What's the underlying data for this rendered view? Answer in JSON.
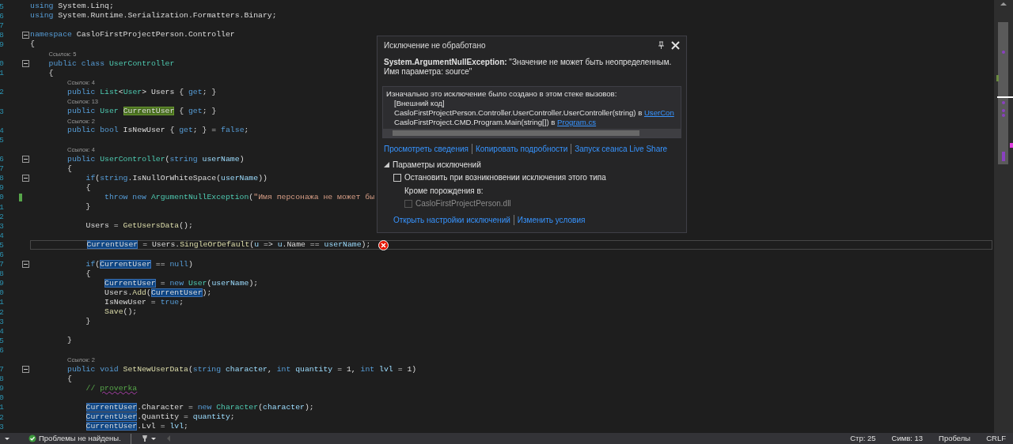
{
  "editor": {
    "lines": [
      {
        "kind": "code",
        "number": "5",
        "fold": false,
        "tokens": [
          {
            "text": "using",
            "kind": "k"
          },
          {
            "text": " System.Linq;",
            "kind": "n"
          }
        ]
      },
      {
        "kind": "code",
        "number": "6",
        "fold": false,
        "tokens": [
          {
            "text": "using",
            "kind": "k"
          },
          {
            "text": " System.Runtime.Serialization.Formatters.Binary;",
            "kind": "n"
          }
        ]
      },
      {
        "kind": "code",
        "number": "7",
        "fold": false
      },
      {
        "kind": "code",
        "number": "8",
        "fold": true,
        "tokens": [
          {
            "text": "namespace",
            "kind": "k"
          },
          {
            "text": " CasloFirstProjectPerson.Controller",
            "kind": "n"
          }
        ]
      },
      {
        "kind": "code",
        "number": "9",
        "fold": false,
        "tokens": [
          {
            "text": "{",
            "kind": "n"
          }
        ]
      },
      {
        "kind": "lens",
        "text": "    Ссылок: 5"
      },
      {
        "kind": "code",
        "number": "0",
        "fold": true,
        "tokens": [
          {
            "text": "    public class ",
            "kind": "k"
          },
          {
            "text": "UserController",
            "kind": "t"
          }
        ]
      },
      {
        "kind": "code",
        "number": "1",
        "fold": false,
        "tokens": [
          {
            "text": "    {",
            "kind": "n"
          }
        ]
      },
      {
        "kind": "lens",
        "text": "        Ссылок: 4"
      },
      {
        "kind": "code",
        "number": "2",
        "fold": false,
        "tokens": [
          {
            "text": "        public ",
            "kind": "k"
          },
          {
            "text": "List",
            "kind": "t"
          },
          {
            "text": "<",
            "kind": "n"
          },
          {
            "text": "User",
            "kind": "t"
          },
          {
            "text": "> Users { ",
            "kind": "n"
          },
          {
            "text": "get",
            "kind": "k"
          },
          {
            "text": "; }",
            "kind": "n"
          }
        ]
      },
      {
        "kind": "lens",
        "text": "        Ссылок: 13"
      },
      {
        "kind": "code",
        "number": "3",
        "fold": false,
        "tokens": [
          {
            "text": "        public ",
            "kind": "k"
          },
          {
            "text": "User ",
            "kind": "t"
          },
          {
            "text": "CurrentUser",
            "kind": "d"
          },
          {
            "text": " { ",
            "kind": "n"
          },
          {
            "text": "get",
            "kind": "k"
          },
          {
            "text": "; }",
            "kind": "n"
          }
        ]
      },
      {
        "kind": "lens",
        "text": "        Ссылок: 2"
      },
      {
        "kind": "code",
        "number": "4",
        "fold": false,
        "tokens": [
          {
            "text": "        public bool",
            "kind": "k"
          },
          {
            "text": " IsNewUser { ",
            "kind": "n"
          },
          {
            "text": "get",
            "kind": "k"
          },
          {
            "text": "; } = ",
            "kind": "n"
          },
          {
            "text": "false",
            "kind": "k"
          },
          {
            "text": ";",
            "kind": "n"
          }
        ]
      },
      {
        "kind": "code",
        "number": "5",
        "fold": false
      },
      {
        "kind": "lens",
        "text": "        Ссылок: 4"
      },
      {
        "kind": "code",
        "number": "6",
        "fold": true,
        "tokens": [
          {
            "text": "        public ",
            "kind": "k"
          },
          {
            "text": "UserController",
            "kind": "t"
          },
          {
            "text": "(",
            "kind": "n"
          },
          {
            "text": "string ",
            "kind": "k"
          },
          {
            "text": "userName",
            "kind": "p"
          },
          {
            "text": ")",
            "kind": "n"
          }
        ]
      },
      {
        "kind": "code",
        "number": "7",
        "fold": false,
        "tokens": [
          {
            "text": "        {",
            "kind": "n"
          }
        ]
      },
      {
        "kind": "code",
        "number": "8",
        "fold": true,
        "tokens": [
          {
            "text": "            if",
            "kind": "k"
          },
          {
            "text": "(",
            "kind": "n"
          },
          {
            "text": "string",
            "kind": "k"
          },
          {
            "text": ".IsNullOrWhiteSpace(",
            "kind": "n"
          },
          {
            "text": "userName",
            "kind": "p"
          },
          {
            "text": "))",
            "kind": "n"
          }
        ]
      },
      {
        "kind": "code",
        "number": "9",
        "fold": false,
        "tokens": [
          {
            "text": "            {",
            "kind": "n"
          }
        ]
      },
      {
        "kind": "code",
        "number": "0",
        "fold": false,
        "changed": true,
        "tokens": [
          {
            "text": "                throw new ",
            "kind": "k"
          },
          {
            "text": "ArgumentNullException",
            "kind": "t"
          },
          {
            "text": "(",
            "kind": "n"
          },
          {
            "text": "\"Имя персонажа не может бы",
            "kind": "s"
          }
        ]
      },
      {
        "kind": "code",
        "number": "1",
        "fold": false,
        "tokens": [
          {
            "text": "            }",
            "kind": "n"
          }
        ]
      },
      {
        "kind": "code",
        "number": "2",
        "fold": false
      },
      {
        "kind": "code",
        "number": "3",
        "fold": false,
        "tokens": [
          {
            "text": "            Users = ",
            "kind": "n"
          },
          {
            "text": "GetUsersData",
            "kind": "m"
          },
          {
            "text": "();",
            "kind": "n"
          }
        ]
      },
      {
        "kind": "code",
        "number": "4",
        "fold": false
      },
      {
        "kind": "code",
        "number": "5",
        "fold": false,
        "current": true,
        "error": true,
        "tokens": [
          {
            "text": "            CurrentUser",
            "kind": "r"
          },
          {
            "text": " = Users.",
            "kind": "n"
          },
          {
            "text": "SingleOrDefault",
            "kind": "m"
          },
          {
            "text": "(",
            "kind": "n"
          },
          {
            "text": "u",
            "kind": "p"
          },
          {
            "text": " => ",
            "kind": "n"
          },
          {
            "text": "u",
            "kind": "p"
          },
          {
            "text": ".Name == ",
            "kind": "n"
          },
          {
            "text": "userName",
            "kind": "p"
          },
          {
            "text": ");",
            "kind": "n"
          }
        ]
      },
      {
        "kind": "code",
        "number": "6",
        "fold": false
      },
      {
        "kind": "code",
        "number": "7",
        "fold": true,
        "tokens": [
          {
            "text": "            if",
            "kind": "k"
          },
          {
            "text": "(",
            "kind": "n"
          },
          {
            "text": "CurrentUser",
            "kind": "r"
          },
          {
            "text": " == ",
            "kind": "n"
          },
          {
            "text": "null",
            "kind": "k"
          },
          {
            "text": ")",
            "kind": "n"
          }
        ]
      },
      {
        "kind": "code",
        "number": "8",
        "fold": false,
        "tokens": [
          {
            "text": "            {",
            "kind": "n"
          }
        ]
      },
      {
        "kind": "code",
        "number": "9",
        "fold": false,
        "tokens": [
          {
            "text": "                CurrentUser",
            "kind": "r"
          },
          {
            "text": " = ",
            "kind": "n"
          },
          {
            "text": "new ",
            "kind": "k"
          },
          {
            "text": "User",
            "kind": "t"
          },
          {
            "text": "(",
            "kind": "n"
          },
          {
            "text": "userName",
            "kind": "p"
          },
          {
            "text": ");",
            "kind": "n"
          }
        ]
      },
      {
        "kind": "code",
        "number": "0",
        "fold": false,
        "tokens": [
          {
            "text": "                Users.",
            "kind": "n"
          },
          {
            "text": "Add",
            "kind": "m"
          },
          {
            "text": "(",
            "kind": "n"
          },
          {
            "text": "CurrentUser",
            "kind": "r"
          },
          {
            "text": ");",
            "kind": "n"
          }
        ]
      },
      {
        "kind": "code",
        "number": "1",
        "fold": false,
        "tokens": [
          {
            "text": "                IsNewUser = ",
            "kind": "n"
          },
          {
            "text": "true",
            "kind": "k"
          },
          {
            "text": ";",
            "kind": "n"
          }
        ]
      },
      {
        "kind": "code",
        "number": "2",
        "fold": false,
        "tokens": [
          {
            "text": "                Save",
            "kind": "m"
          },
          {
            "text": "();",
            "kind": "n"
          }
        ]
      },
      {
        "kind": "code",
        "number": "3",
        "fold": false,
        "tokens": [
          {
            "text": "            }",
            "kind": "n"
          }
        ]
      },
      {
        "kind": "code",
        "number": "4",
        "fold": false
      },
      {
        "kind": "code",
        "number": "5",
        "fold": false,
        "tokens": [
          {
            "text": "        }",
            "kind": "n"
          }
        ]
      },
      {
        "kind": "code",
        "number": "6",
        "fold": false
      },
      {
        "kind": "lens",
        "text": "        Ссылок: 2"
      },
      {
        "kind": "code",
        "number": "7",
        "fold": true,
        "tokens": [
          {
            "text": "        public void ",
            "kind": "k"
          },
          {
            "text": "SetNewUserData",
            "kind": "m"
          },
          {
            "text": "(",
            "kind": "n"
          },
          {
            "text": "string ",
            "kind": "k"
          },
          {
            "text": "character",
            "kind": "p"
          },
          {
            "text": ", ",
            "kind": "n"
          },
          {
            "text": "int ",
            "kind": "k"
          },
          {
            "text": "quantity",
            "kind": "p"
          },
          {
            "text": " = 1, ",
            "kind": "n"
          },
          {
            "text": "int ",
            "kind": "k"
          },
          {
            "text": "lvl",
            "kind": "p"
          },
          {
            "text": " = 1)",
            "kind": "n"
          }
        ]
      },
      {
        "kind": "code",
        "number": "8",
        "fold": false,
        "tokens": [
          {
            "text": "        {",
            "kind": "n"
          }
        ]
      },
      {
        "kind": "code",
        "number": "9",
        "fold": false,
        "tokens": [
          {
            "text": "            // ",
            "kind": "c"
          },
          {
            "text": "proverka",
            "kind": "q"
          }
        ]
      },
      {
        "kind": "code",
        "number": "0",
        "fold": false
      },
      {
        "kind": "code",
        "number": "1",
        "fold": false,
        "tokens": [
          {
            "text": "            CurrentUser",
            "kind": "r"
          },
          {
            "text": ".Character = ",
            "kind": "n"
          },
          {
            "text": "new ",
            "kind": "k"
          },
          {
            "text": "Character",
            "kind": "t"
          },
          {
            "text": "(",
            "kind": "n"
          },
          {
            "text": "character",
            "kind": "p"
          },
          {
            "text": ");",
            "kind": "n"
          }
        ]
      },
      {
        "kind": "code",
        "number": "2",
        "fold": false,
        "tokens": [
          {
            "text": "            CurrentUser",
            "kind": "r"
          },
          {
            "text": ".Quantity = ",
            "kind": "n"
          },
          {
            "text": "quantity",
            "kind": "p"
          },
          {
            "text": ";",
            "kind": "n"
          }
        ]
      },
      {
        "kind": "code",
        "number": "3",
        "fold": false,
        "tokens": [
          {
            "text": "            CurrentUser",
            "kind": "r"
          },
          {
            "text": ".Lvl = ",
            "kind": "n"
          },
          {
            "text": "lvl",
            "kind": "p"
          },
          {
            "text": ";",
            "kind": "n"
          }
        ]
      }
    ]
  },
  "exception_popup": {
    "title": "Исключение не обработано",
    "message": "**System.ArgumentNullException:** \"Значение не может быть неопределенным.\nИмя параметра: source\"",
    "stack_heading": "Изначально это исключение было создано в этом стеке вызовов:",
    "frames": [
      {
        "text": "[Внешний код]"
      },
      {
        "text": "CasloFirstProjectPerson.Controller.UserController.UserController(string) в ",
        "link": "UserCon"
      },
      {
        "text": "CasloFirstProject.CMD.Program.Main(string[]) в ",
        "link": "Program.cs"
      }
    ],
    "links": [
      "Просмотреть сведения",
      "Копировать подробности",
      "Запуск сеанса Live Share"
    ],
    "settings": {
      "title": "Параметры исключений",
      "expanded": true,
      "break_option": {
        "label": "Остановить при возникновении исключения этого типа",
        "checked": false
      },
      "except_label": "Кроме порождения в:",
      "module_option": {
        "label": "CasloFirstProjectPerson.dll",
        "checked": false,
        "disabled": true
      }
    },
    "bottom_links": [
      "Открыть настройки исключений",
      "Изменить условия"
    ]
  },
  "status_bar": {
    "issues": "Проблемы не найдены.",
    "line": "Стр: 25",
    "column": "Симв: 13",
    "indent": "Пробелы",
    "line_ending": "CRLF"
  }
}
